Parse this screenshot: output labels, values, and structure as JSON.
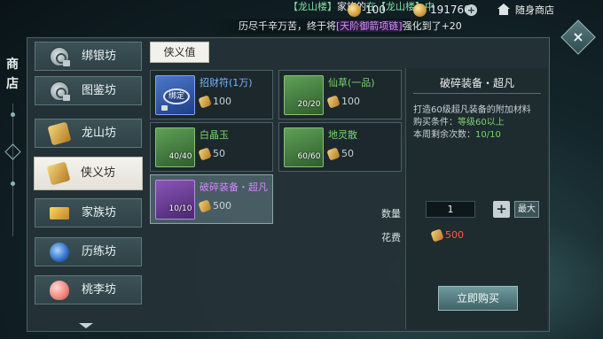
{
  "top": {
    "ticker": {
      "prefix": "【龙山楼】",
      "middle": "家族的",
      "suffix": "在【龙山楼】中",
      "extra": "【龙山楼】"
    },
    "currency1": "100",
    "currency2": "191760",
    "shop_label": "随身商店"
  },
  "notice": {
    "pre": "历尽千辛万苦，终于将",
    "highlight": "[天阶御箭项链]",
    "post": "强化到了+20"
  },
  "side_title": "商店",
  "nav": [
    {
      "label": "绑银坊",
      "icon": "silver-coin-icon"
    },
    {
      "label": "图鉴坊",
      "icon": "codex-coin-icon"
    },
    {
      "label": "龙山坊",
      "icon": "dragon-ingot-icon"
    },
    {
      "label": "侠义坊",
      "icon": "chivalry-ingot-icon"
    },
    {
      "label": "家族坊",
      "icon": "gold-bar-icon"
    },
    {
      "label": "历练坊",
      "icon": "blue-orb-icon"
    },
    {
      "label": "桃李坊",
      "icon": "peach-icon"
    }
  ],
  "tab": "侠义值",
  "items": [
    {
      "name": "招财符(1万)",
      "price": "100",
      "count": "",
      "tag": "绑定",
      "color": "blue"
    },
    {
      "name": "仙草(一品)",
      "price": "100",
      "count": "20/20",
      "color": "green"
    },
    {
      "name": "白晶玉",
      "price": "50",
      "count": "40/40",
      "color": "green"
    },
    {
      "name": "地灵散",
      "price": "50",
      "count": "60/60",
      "color": "green"
    },
    {
      "name": "破碎装备・超凡",
      "price": "500",
      "count": "10/10",
      "color": "purple"
    }
  ],
  "detail": {
    "title": "破碎装备・超凡",
    "desc": "打造60级超凡装备的附加材料",
    "cond_label": "购买条件：",
    "cond_value": "等级60以上",
    "left_label": "本周剩余次数：",
    "left_value": "10/10"
  },
  "qty": {
    "label": "数量",
    "value": "1",
    "max_label": "最大"
  },
  "cost": {
    "label": "花费",
    "value": "500"
  },
  "buy_label": "立即购买",
  "colors": {
    "accent_green": "#7bd46d",
    "accent_blue": "#7ab6ff",
    "accent_purple": "#d486ff",
    "cost_red": "#ff5a4a"
  }
}
